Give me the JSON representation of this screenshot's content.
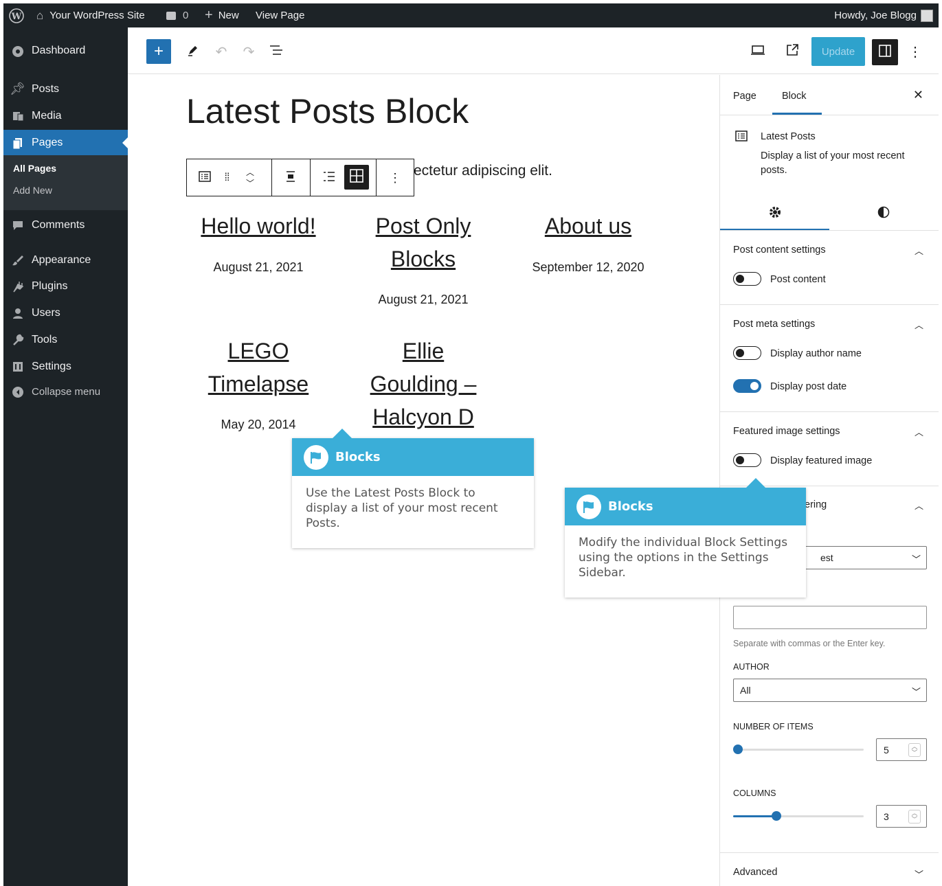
{
  "admin_bar": {
    "site_name": "Your WordPress Site",
    "comments_count": "0",
    "new_label": "New",
    "view_page_label": "View Page",
    "howdy": "Howdy, Joe Blogg"
  },
  "sidebar": {
    "items": [
      {
        "label": "Dashboard",
        "icon": "dashboard-icon"
      },
      {
        "label": "Posts",
        "icon": "pin-icon"
      },
      {
        "label": "Media",
        "icon": "media-icon"
      },
      {
        "label": "Pages",
        "icon": "pages-icon"
      },
      {
        "label": "Comments",
        "icon": "comment-icon"
      },
      {
        "label": "Appearance",
        "icon": "brush-icon"
      },
      {
        "label": "Plugins",
        "icon": "plug-icon"
      },
      {
        "label": "Users",
        "icon": "user-icon"
      },
      {
        "label": "Tools",
        "icon": "wrench-icon"
      },
      {
        "label": "Settings",
        "icon": "settings-icon"
      },
      {
        "label": "Collapse menu",
        "icon": "collapse-icon"
      }
    ],
    "submenu": [
      "All Pages",
      "Add New"
    ]
  },
  "toolbar": {
    "update_label": "Update"
  },
  "editor": {
    "page_title": "Latest Posts Block",
    "paragraph_fragment": "ectetur adipiscing elit.",
    "posts": [
      {
        "title": "Hello world!",
        "date": "August 21, 2021"
      },
      {
        "title": "Post Only Blocks",
        "date": "August 21, 2021"
      },
      {
        "title": "About us",
        "date": "September 12, 2020"
      },
      {
        "title": "LEGO Timelapse",
        "date": "May 20, 2014"
      },
      {
        "title": "Ellie Goulding – Halcyon D",
        "date": ""
      }
    ]
  },
  "settings_sidebar": {
    "tab_page": "Page",
    "tab_block": "Block",
    "block_name": "Latest Posts",
    "block_desc": "Display a list of your most recent posts.",
    "panels": {
      "content": {
        "title": "Post content settings",
        "toggles": [
          {
            "label": "Post content",
            "on": false
          }
        ]
      },
      "meta": {
        "title": "Post meta settings",
        "toggles": [
          {
            "label": "Display author name",
            "on": false
          },
          {
            "label": "Display post date",
            "on": true
          }
        ]
      },
      "image": {
        "title": "Featured image settings",
        "toggles": [
          {
            "label": "Display featured image",
            "on": false
          }
        ]
      },
      "sorting": {
        "title_fragment": "ering",
        "order_fragment": "est"
      }
    },
    "categories_help": "Separate with commas or the Enter key.",
    "author_label": "AUTHOR",
    "author_value": "All",
    "number_label": "NUMBER OF ITEMS",
    "number_value": "5",
    "number_fraction": 0.0,
    "columns_label": "COLUMNS",
    "columns_value": "3",
    "columns_fraction": 0.33,
    "advanced_label": "Advanced"
  },
  "tooltips": [
    {
      "title": "Blocks",
      "body": "Use the Latest Posts Block to display a list of your most recent Posts."
    },
    {
      "title": "Blocks",
      "body": "Modify the individual Block Settings using the options in the Settings Sidebar."
    }
  ],
  "colors": {
    "accent": "#2271b1",
    "tooltip": "#3aaed8",
    "admin_dark": "#1d2327"
  }
}
